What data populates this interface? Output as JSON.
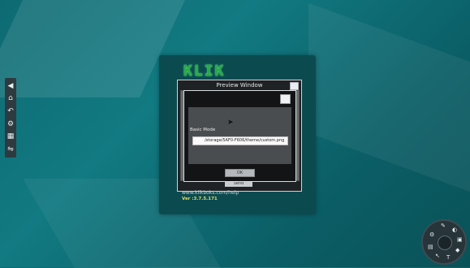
{
  "sidebar": {
    "icons": [
      {
        "name": "back-arrow-icon",
        "glyph": "◀"
      },
      {
        "name": "home-icon",
        "glyph": "⌂"
      },
      {
        "name": "undo-icon",
        "glyph": "↶"
      },
      {
        "name": "settings-icon",
        "glyph": "⚙"
      },
      {
        "name": "grid-icon",
        "glyph": "▦"
      },
      {
        "name": "adjust-icon",
        "glyph": "⇋"
      }
    ]
  },
  "app": {
    "logo": "KLIK",
    "help_link": "www.klikboks.com/help",
    "version": "Ver :3.7.5.171"
  },
  "preview_window": {
    "title": "Preview Window",
    "send_label": "Send"
  },
  "dialog": {
    "mode_label": "Basic Mode",
    "path_value": "/storage/5AF0-F606/theme/custom.png",
    "ok_label": "OK"
  },
  "dial_menu": {
    "icons": [
      "pen-icon",
      "palette-icon",
      "eraser-icon",
      "shapes-icon",
      "text-icon",
      "pointer-icon",
      "image-icon",
      "settings-icon"
    ]
  },
  "colors": {
    "background": "#0e6a72",
    "logo": "#2ba84a",
    "version": "#e3d95a"
  }
}
